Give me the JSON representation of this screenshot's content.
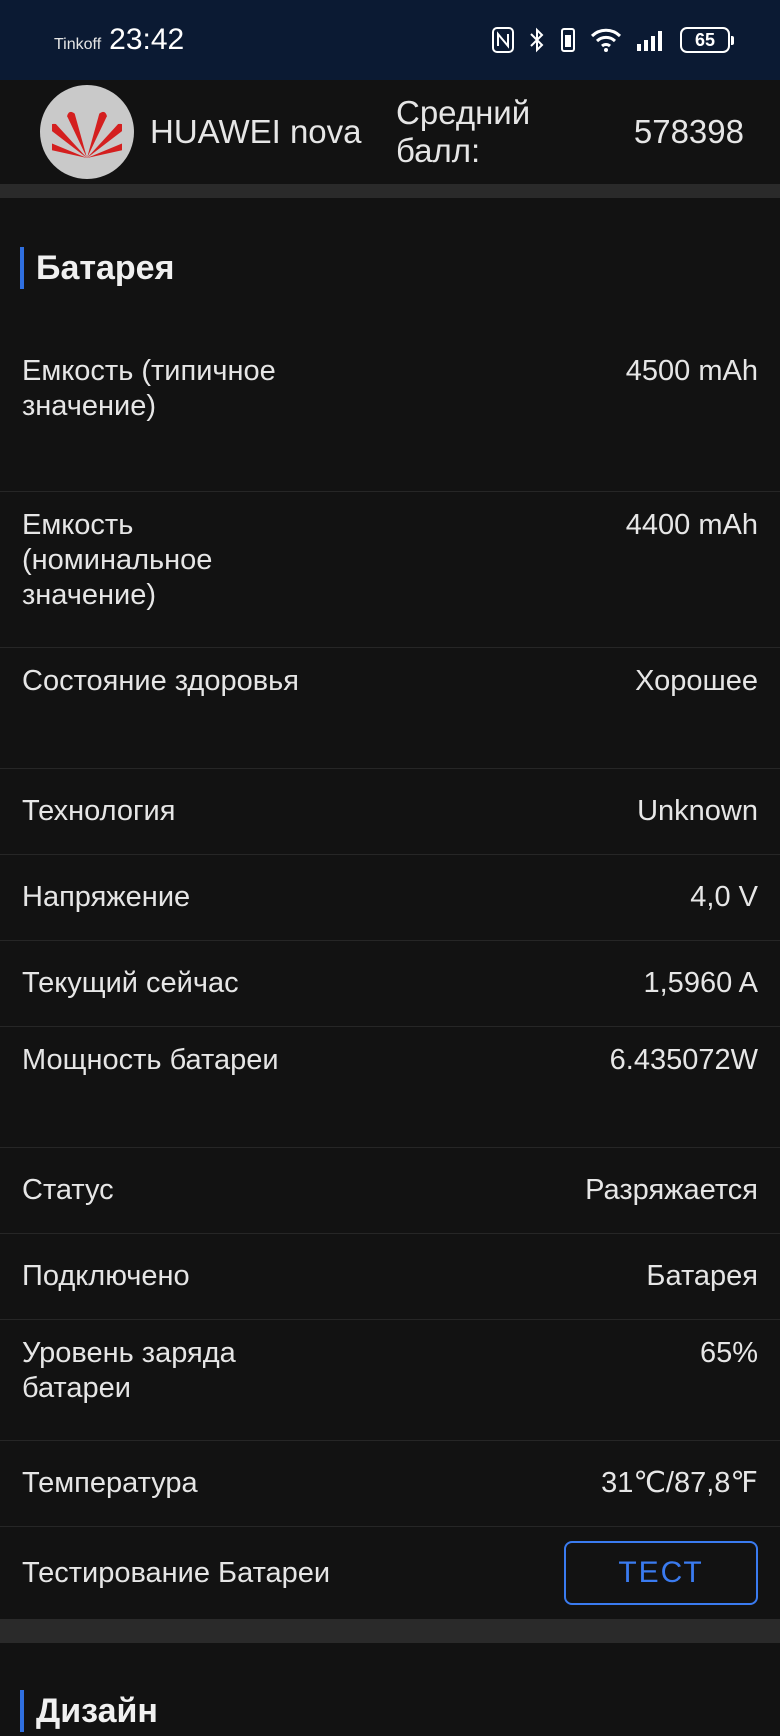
{
  "status_bar": {
    "carrier": "Tinkoff",
    "time": "23:42",
    "icons": [
      "nfc-icon",
      "bluetooth-icon",
      "vibrate-icon",
      "wifi-icon",
      "signal-icon"
    ],
    "battery": "65"
  },
  "header": {
    "device_name": "HUAWEI nova",
    "avg_label": "Средний балл:",
    "avg_value": "578398",
    "logo": "huawei-logo"
  },
  "battery_section": {
    "title": "Батарея",
    "rows": [
      {
        "label": "Емкость (типичное значение)",
        "value": "4500 mAh"
      },
      {
        "label": "Емкость (номинальное значение)",
        "value": "4400 mAh"
      },
      {
        "label": "Состояние здоровья",
        "value": "Хорошее"
      },
      {
        "label": "Технология",
        "value": "Unknown"
      },
      {
        "label": "Напряжение",
        "value": "4,0 V"
      },
      {
        "label": "Текущий сейчас",
        "value": "1,5960 A"
      },
      {
        "label": "Мощность батареи",
        "value": "6.435072W"
      },
      {
        "label": "Статус",
        "value": "Разряжается"
      },
      {
        "label": "Подключено",
        "value": "Батарея"
      },
      {
        "label": "Уровень заряда батареи",
        "value": "65%"
      },
      {
        "label": "Температура",
        "value": "31℃/87,8℉"
      }
    ],
    "test_label": "Тестирование Батареи",
    "test_button": "ТЕСТ"
  },
  "design_section": {
    "title": "Дизайн"
  },
  "colors": {
    "accent": "#2f6fe0",
    "background": "#121212",
    "statusbar": "#0b1a33"
  }
}
